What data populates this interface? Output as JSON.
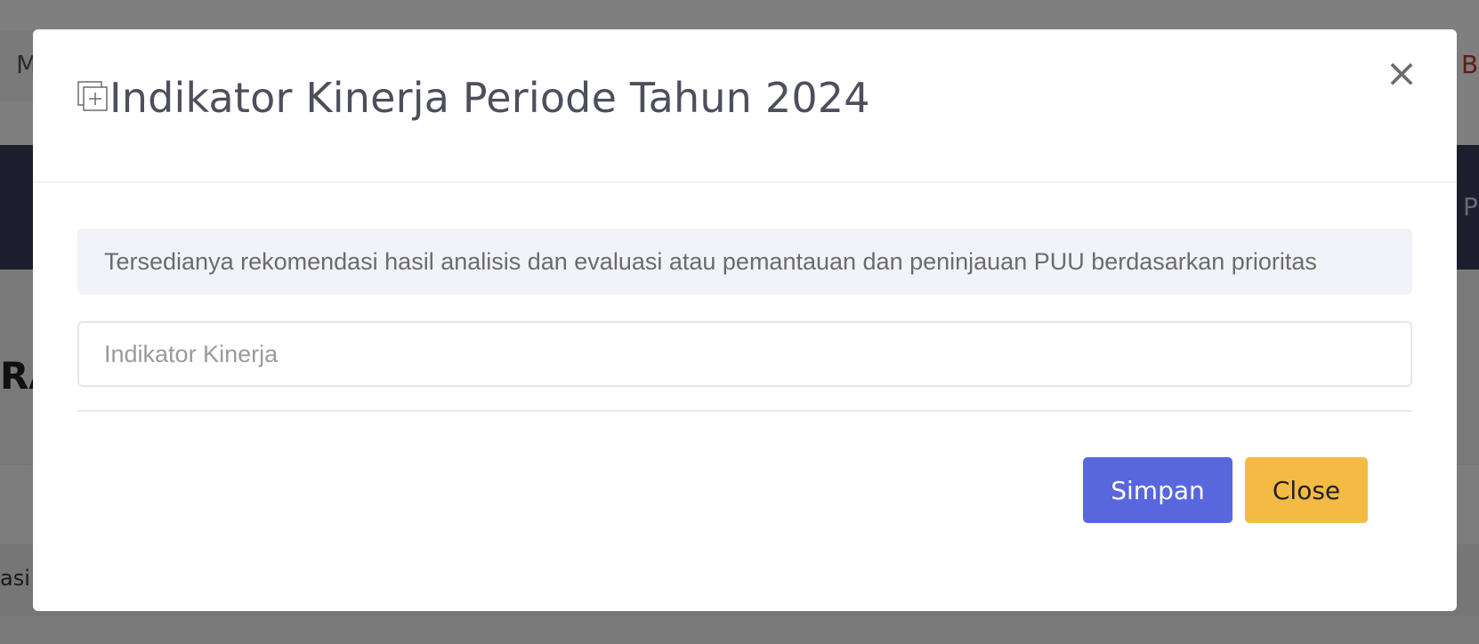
{
  "background": {
    "top_left_text": "M",
    "top_right_text": "B",
    "nav_right_text": "P",
    "heading_text": "RA",
    "row_text": "asi"
  },
  "modal": {
    "title": "Indikator Kinerja Periode Tahun 2024",
    "title_icon": "add-copy-icon",
    "close_icon": "close-icon",
    "close_glyph": "×",
    "info_text": "Tersedianya rekomendasi hasil analisis dan evaluasi atau pemantauan dan peninjauan PUU berdasarkan prioritas",
    "input": {
      "value": "",
      "placeholder": "Indikator Kinerja"
    },
    "buttons": {
      "save_label": "Simpan",
      "close_label": "Close"
    }
  },
  "colors": {
    "save_button": "#5867dd",
    "close_button": "#f4bb44",
    "title_text": "#4d4f5c",
    "info_background": "#f2f3f8",
    "navbar_background": "#3a3a5c"
  }
}
